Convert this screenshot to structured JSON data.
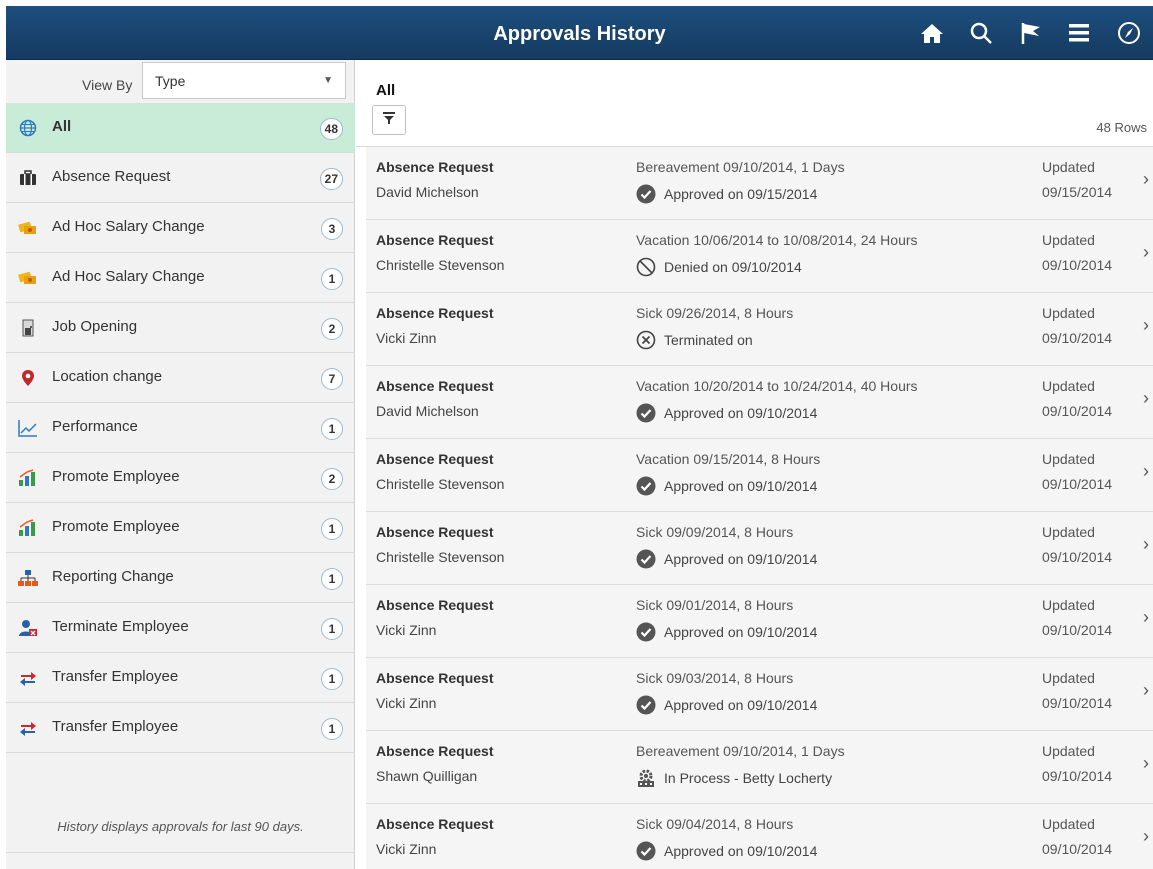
{
  "header": {
    "title": "Approvals History",
    "icons": [
      "home-icon",
      "search-icon",
      "flag-icon",
      "menu-icon",
      "compass-icon"
    ]
  },
  "filter": {
    "view_by_label": "View By",
    "view_by_value": "Type"
  },
  "nav": [
    {
      "label": "All",
      "count": "48",
      "icon": "globe-icon",
      "active": true
    },
    {
      "label": "Absence Request",
      "count": "27",
      "icon": "suitcase-icon"
    },
    {
      "label": "Ad Hoc Salary Change",
      "count": "3",
      "icon": "money-icon"
    },
    {
      "label": "Ad Hoc Salary Change",
      "count": "1",
      "icon": "money-icon"
    },
    {
      "label": "Job Opening",
      "count": "2",
      "icon": "door-icon"
    },
    {
      "label": "Location change",
      "count": "7",
      "icon": "pin-icon"
    },
    {
      "label": "Performance",
      "count": "1",
      "icon": "line-chart-icon"
    },
    {
      "label": "Promote Employee",
      "count": "2",
      "icon": "bar-chart-icon"
    },
    {
      "label": "Promote Employee",
      "count": "1",
      "icon": "bar-chart-icon"
    },
    {
      "label": "Reporting Change",
      "count": "1",
      "icon": "org-chart-icon"
    },
    {
      "label": "Terminate Employee",
      "count": "1",
      "icon": "terminate-user-icon"
    },
    {
      "label": "Transfer Employee",
      "count": "1",
      "icon": "transfer-icon"
    },
    {
      "label": "Transfer Employee",
      "count": "1",
      "icon": "transfer-icon"
    }
  ],
  "note": "History displays approvals for last 90 days.",
  "main": {
    "title": "All",
    "rows_count": "48 Rows",
    "rows": [
      {
        "type": "Absence Request",
        "name": "David Michelson",
        "detail": "Bereavement 09/10/2014, 1 Days",
        "status": "Approved on 09/15/2014",
        "status_icon": "approved",
        "updated_label": "Updated",
        "updated_date": "09/15/2014"
      },
      {
        "type": "Absence Request",
        "name": "Christelle Stevenson",
        "detail": "Vacation 10/06/2014 to  10/08/2014, 24 Hours",
        "status": "Denied on 09/10/2014",
        "status_icon": "denied",
        "updated_label": "Updated",
        "updated_date": "09/10/2014"
      },
      {
        "type": "Absence Request",
        "name": "Vicki Zinn",
        "detail": "Sick 09/26/2014, 8 Hours",
        "status": "Terminated on",
        "status_icon": "terminated",
        "updated_label": "Updated",
        "updated_date": "09/10/2014"
      },
      {
        "type": "Absence Request",
        "name": "David Michelson",
        "detail": "Vacation 10/20/2014 to  10/24/2014, 40 Hours",
        "status": "Approved on 09/10/2014",
        "status_icon": "approved",
        "updated_label": "Updated",
        "updated_date": "09/10/2014"
      },
      {
        "type": "Absence Request",
        "name": "Christelle Stevenson",
        "detail": "Vacation 09/15/2014, 8 Hours",
        "status": "Approved on 09/10/2014",
        "status_icon": "approved",
        "updated_label": "Updated",
        "updated_date": "09/10/2014"
      },
      {
        "type": "Absence Request",
        "name": "Christelle Stevenson",
        "detail": "Sick 09/09/2014, 8 Hours",
        "status": "Approved on 09/10/2014",
        "status_icon": "approved",
        "updated_label": "Updated",
        "updated_date": "09/10/2014"
      },
      {
        "type": "Absence Request",
        "name": "Vicki Zinn",
        "detail": "Sick 09/01/2014, 8 Hours",
        "status": "Approved on 09/10/2014",
        "status_icon": "approved",
        "updated_label": "Updated",
        "updated_date": "09/10/2014"
      },
      {
        "type": "Absence Request",
        "name": "Vicki Zinn",
        "detail": "Sick 09/03/2014, 8 Hours",
        "status": "Approved on 09/10/2014",
        "status_icon": "approved",
        "updated_label": "Updated",
        "updated_date": "09/10/2014"
      },
      {
        "type": "Absence Request",
        "name": "Shawn Quilligan",
        "detail": "Bereavement 09/10/2014, 1 Days",
        "status": "In Process - Betty Locherty",
        "status_icon": "in-process",
        "updated_label": "Updated",
        "updated_date": "09/10/2014"
      },
      {
        "type": "Absence Request",
        "name": "Vicki Zinn",
        "detail": "Sick 09/04/2014, 8 Hours",
        "status": "Approved on 09/10/2014",
        "status_icon": "approved",
        "updated_label": "Updated",
        "updated_date": "09/10/2014"
      }
    ]
  },
  "colors": {
    "header_bg": "#1d4f7e",
    "active_nav_bg": "#c8ecd8",
    "panel_bg": "#f2f2f2"
  }
}
